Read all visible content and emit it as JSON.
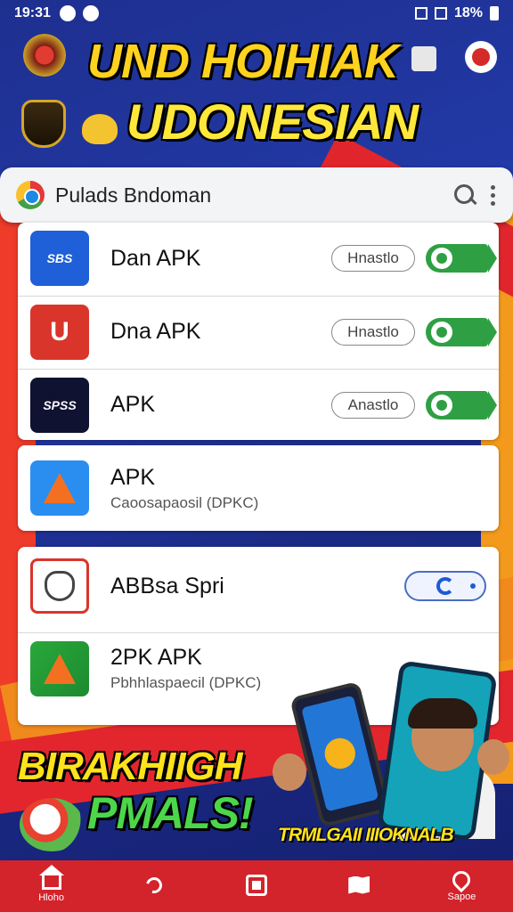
{
  "status_bar": {
    "time": "19:31",
    "battery": "18%"
  },
  "header": {
    "title_line1": "UND HOIHIAK",
    "title_line2": "UDONESIAN"
  },
  "search": {
    "value": "Pulads Bndoman"
  },
  "apps": [
    {
      "name": "Dan APK",
      "icon_text": "SBS",
      "action_label": "Hnastlo"
    },
    {
      "name": "Dna APK",
      "icon_text": "U",
      "action_label": "Hnastlo"
    },
    {
      "name": "APK",
      "icon_text": "SPSS",
      "action_label": "Anastlo"
    },
    {
      "name": "APK",
      "subtitle": "Caoosapaosil (DPKC)"
    },
    {
      "name": "ABBsa Spri"
    },
    {
      "name": "2PK APK",
      "subtitle": "Pbhhlaspaecil (DPKC)"
    }
  ],
  "promo": {
    "line1": "BIRAKHIIGH",
    "line2": "PMALS!",
    "tagline": "TRMLGAII IIIOKNALB"
  },
  "bottom_nav": [
    {
      "label": "Hloho",
      "icon": "home-icon"
    },
    {
      "label": "",
      "icon": "link-icon"
    },
    {
      "label": "",
      "icon": "square-icon"
    },
    {
      "label": "",
      "icon": "map-icon"
    },
    {
      "label": "Sapoe",
      "icon": "pin-icon"
    }
  ],
  "colors": {
    "accent_red": "#d3232b",
    "install_green": "#2ea043",
    "background_blue": "#1e2f8f",
    "headline_yellow": "#ffd21f"
  }
}
